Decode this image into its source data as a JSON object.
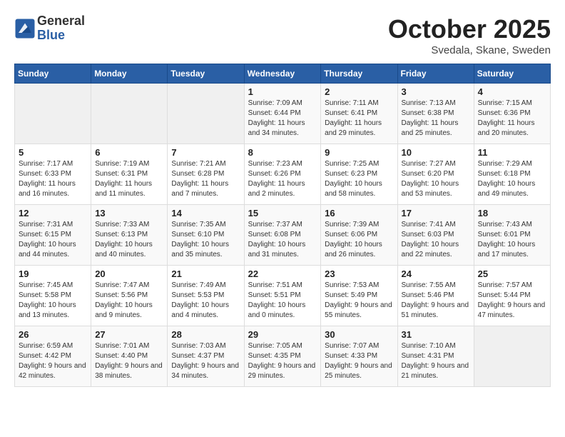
{
  "logo": {
    "general": "General",
    "blue": "Blue"
  },
  "header": {
    "month": "October 2025",
    "location": "Svedala, Skane, Sweden"
  },
  "weekdays": [
    "Sunday",
    "Monday",
    "Tuesday",
    "Wednesday",
    "Thursday",
    "Friday",
    "Saturday"
  ],
  "weeks": [
    [
      {
        "day": "",
        "sunrise": "",
        "sunset": "",
        "daylight": ""
      },
      {
        "day": "",
        "sunrise": "",
        "sunset": "",
        "daylight": ""
      },
      {
        "day": "",
        "sunrise": "",
        "sunset": "",
        "daylight": ""
      },
      {
        "day": "1",
        "sunrise": "Sunrise: 7:09 AM",
        "sunset": "Sunset: 6:44 PM",
        "daylight": "Daylight: 11 hours and 34 minutes."
      },
      {
        "day": "2",
        "sunrise": "Sunrise: 7:11 AM",
        "sunset": "Sunset: 6:41 PM",
        "daylight": "Daylight: 11 hours and 29 minutes."
      },
      {
        "day": "3",
        "sunrise": "Sunrise: 7:13 AM",
        "sunset": "Sunset: 6:38 PM",
        "daylight": "Daylight: 11 hours and 25 minutes."
      },
      {
        "day": "4",
        "sunrise": "Sunrise: 7:15 AM",
        "sunset": "Sunset: 6:36 PM",
        "daylight": "Daylight: 11 hours and 20 minutes."
      }
    ],
    [
      {
        "day": "5",
        "sunrise": "Sunrise: 7:17 AM",
        "sunset": "Sunset: 6:33 PM",
        "daylight": "Daylight: 11 hours and 16 minutes."
      },
      {
        "day": "6",
        "sunrise": "Sunrise: 7:19 AM",
        "sunset": "Sunset: 6:31 PM",
        "daylight": "Daylight: 11 hours and 11 minutes."
      },
      {
        "day": "7",
        "sunrise": "Sunrise: 7:21 AM",
        "sunset": "Sunset: 6:28 PM",
        "daylight": "Daylight: 11 hours and 7 minutes."
      },
      {
        "day": "8",
        "sunrise": "Sunrise: 7:23 AM",
        "sunset": "Sunset: 6:26 PM",
        "daylight": "Daylight: 11 hours and 2 minutes."
      },
      {
        "day": "9",
        "sunrise": "Sunrise: 7:25 AM",
        "sunset": "Sunset: 6:23 PM",
        "daylight": "Daylight: 10 hours and 58 minutes."
      },
      {
        "day": "10",
        "sunrise": "Sunrise: 7:27 AM",
        "sunset": "Sunset: 6:20 PM",
        "daylight": "Daylight: 10 hours and 53 minutes."
      },
      {
        "day": "11",
        "sunrise": "Sunrise: 7:29 AM",
        "sunset": "Sunset: 6:18 PM",
        "daylight": "Daylight: 10 hours and 49 minutes."
      }
    ],
    [
      {
        "day": "12",
        "sunrise": "Sunrise: 7:31 AM",
        "sunset": "Sunset: 6:15 PM",
        "daylight": "Daylight: 10 hours and 44 minutes."
      },
      {
        "day": "13",
        "sunrise": "Sunrise: 7:33 AM",
        "sunset": "Sunset: 6:13 PM",
        "daylight": "Daylight: 10 hours and 40 minutes."
      },
      {
        "day": "14",
        "sunrise": "Sunrise: 7:35 AM",
        "sunset": "Sunset: 6:10 PM",
        "daylight": "Daylight: 10 hours and 35 minutes."
      },
      {
        "day": "15",
        "sunrise": "Sunrise: 7:37 AM",
        "sunset": "Sunset: 6:08 PM",
        "daylight": "Daylight: 10 hours and 31 minutes."
      },
      {
        "day": "16",
        "sunrise": "Sunrise: 7:39 AM",
        "sunset": "Sunset: 6:06 PM",
        "daylight": "Daylight: 10 hours and 26 minutes."
      },
      {
        "day": "17",
        "sunrise": "Sunrise: 7:41 AM",
        "sunset": "Sunset: 6:03 PM",
        "daylight": "Daylight: 10 hours and 22 minutes."
      },
      {
        "day": "18",
        "sunrise": "Sunrise: 7:43 AM",
        "sunset": "Sunset: 6:01 PM",
        "daylight": "Daylight: 10 hours and 17 minutes."
      }
    ],
    [
      {
        "day": "19",
        "sunrise": "Sunrise: 7:45 AM",
        "sunset": "Sunset: 5:58 PM",
        "daylight": "Daylight: 10 hours and 13 minutes."
      },
      {
        "day": "20",
        "sunrise": "Sunrise: 7:47 AM",
        "sunset": "Sunset: 5:56 PM",
        "daylight": "Daylight: 10 hours and 9 minutes."
      },
      {
        "day": "21",
        "sunrise": "Sunrise: 7:49 AM",
        "sunset": "Sunset: 5:53 PM",
        "daylight": "Daylight: 10 hours and 4 minutes."
      },
      {
        "day": "22",
        "sunrise": "Sunrise: 7:51 AM",
        "sunset": "Sunset: 5:51 PM",
        "daylight": "Daylight: 10 hours and 0 minutes."
      },
      {
        "day": "23",
        "sunrise": "Sunrise: 7:53 AM",
        "sunset": "Sunset: 5:49 PM",
        "daylight": "Daylight: 9 hours and 55 minutes."
      },
      {
        "day": "24",
        "sunrise": "Sunrise: 7:55 AM",
        "sunset": "Sunset: 5:46 PM",
        "daylight": "Daylight: 9 hours and 51 minutes."
      },
      {
        "day": "25",
        "sunrise": "Sunrise: 7:57 AM",
        "sunset": "Sunset: 5:44 PM",
        "daylight": "Daylight: 9 hours and 47 minutes."
      }
    ],
    [
      {
        "day": "26",
        "sunrise": "Sunrise: 6:59 AM",
        "sunset": "Sunset: 4:42 PM",
        "daylight": "Daylight: 9 hours and 42 minutes."
      },
      {
        "day": "27",
        "sunrise": "Sunrise: 7:01 AM",
        "sunset": "Sunset: 4:40 PM",
        "daylight": "Daylight: 9 hours and 38 minutes."
      },
      {
        "day": "28",
        "sunrise": "Sunrise: 7:03 AM",
        "sunset": "Sunset: 4:37 PM",
        "daylight": "Daylight: 9 hours and 34 minutes."
      },
      {
        "day": "29",
        "sunrise": "Sunrise: 7:05 AM",
        "sunset": "Sunset: 4:35 PM",
        "daylight": "Daylight: 9 hours and 29 minutes."
      },
      {
        "day": "30",
        "sunrise": "Sunrise: 7:07 AM",
        "sunset": "Sunset: 4:33 PM",
        "daylight": "Daylight: 9 hours and 25 minutes."
      },
      {
        "day": "31",
        "sunrise": "Sunrise: 7:10 AM",
        "sunset": "Sunset: 4:31 PM",
        "daylight": "Daylight: 9 hours and 21 minutes."
      },
      {
        "day": "",
        "sunrise": "",
        "sunset": "",
        "daylight": ""
      }
    ]
  ]
}
